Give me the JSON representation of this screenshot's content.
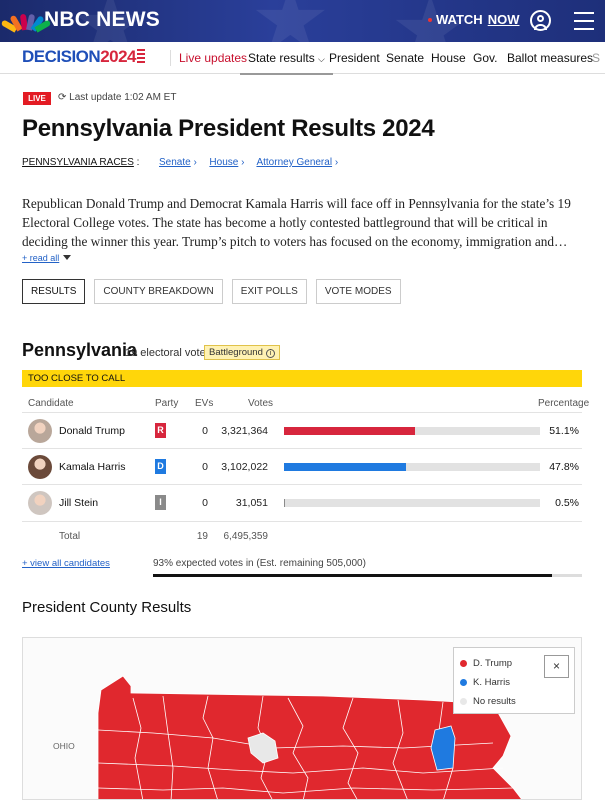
{
  "header": {
    "logo": "NBC NEWS",
    "watch_label": "WATCH",
    "now_label": "NOW",
    "user_icon": "user-circle-icon",
    "menu_icon": "hamburger-menu-icon"
  },
  "decision_nav": {
    "brand": "DECISION",
    "brand_year": "2024",
    "items": [
      "Live updates",
      "State results",
      "President",
      "Senate",
      "House",
      "Gov.",
      "Ballot measures",
      "S"
    ]
  },
  "status": {
    "live": "LIVE",
    "last_update": "Last update 1:02 AM ET"
  },
  "page": {
    "title": "Pennsylvania President Results 2024",
    "races_label": "PENNSYLVANIA RACES",
    "races_colon": ":",
    "races": [
      "Senate",
      "House",
      "Attorney General"
    ],
    "description": "Republican Donald Trump and Democrat Kamala Harris will face off in Pennsylvania for the state’s 19 Electoral College votes. The state has become a hotly contested battleground that will be critical in deciding the winner this year. Trump’s pitch to voters has focused on the economy, immigration and…",
    "read_all": "+ read all",
    "tabs": [
      "RESULTS",
      "COUNTY BREAKDOWN",
      "EXIT POLLS",
      "VOTE MODES"
    ]
  },
  "results": {
    "state": "Pennsylvania",
    "electoral_votes": "19 electoral votes",
    "badge": "Battleground",
    "badge_icon": "info-icon",
    "call_status": "TOO CLOSE TO CALL",
    "headers": {
      "candidate": "Candidate",
      "party": "Party",
      "evs": "EVs",
      "votes": "Votes",
      "percentage": "Percentage"
    },
    "candidates": [
      {
        "name": "Donald Trump",
        "party": "R",
        "party_color": "#d7263d",
        "evs": "0",
        "votes": "3,321,364",
        "pct": "51.1%",
        "share": 51.1,
        "bar_color": "#d7263d",
        "avatar_bg": "#b9a79a"
      },
      {
        "name": "Kamala Harris",
        "party": "D",
        "party_color": "#1f7ae0",
        "evs": "0",
        "votes": "3,102,022",
        "pct": "47.8%",
        "share": 47.8,
        "bar_color": "#1f7ae0",
        "avatar_bg": "#6b4a3a"
      },
      {
        "name": "Jill Stein",
        "party": "I",
        "party_color": "#8a8a8a",
        "evs": "0",
        "votes": "31,051",
        "pct": "0.5%",
        "share": 0.5,
        "bar_color": "#8a8a8a",
        "avatar_bg": "#cfc6c0"
      }
    ],
    "total_label": "Total",
    "total_evs": "19",
    "total_votes": "6,495,359",
    "view_all": "+ view all candidates",
    "expected": "93% expected votes in (Est. remaining 505,000)",
    "expected_share": 93
  },
  "county": {
    "title": "President County Results",
    "legend": [
      {
        "label": "D. Trump",
        "color": "#e0282e"
      },
      {
        "label": "K. Harris",
        "color": "#1f7ae0"
      },
      {
        "label": "No results",
        "color": "#e8e8e8"
      }
    ],
    "close_label": "×",
    "neighbor_label": "OHIO"
  }
}
